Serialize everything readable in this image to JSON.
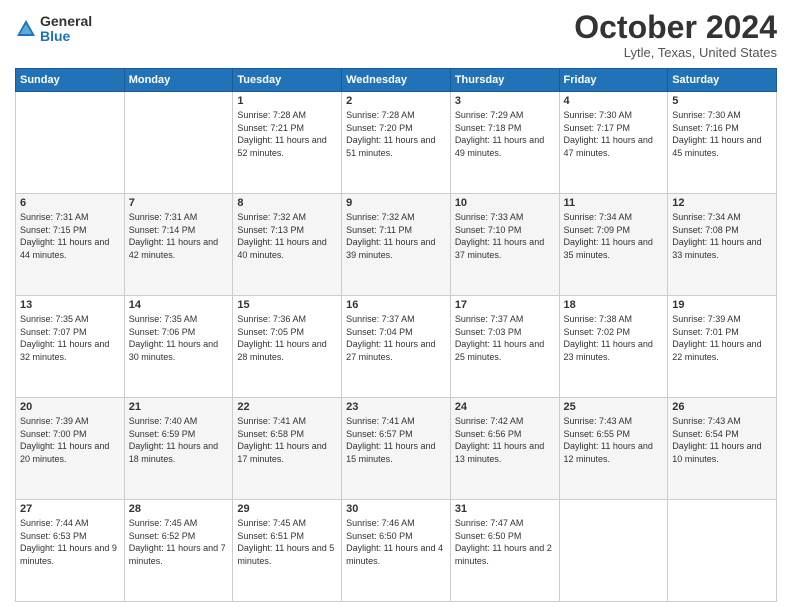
{
  "logo": {
    "general": "General",
    "blue": "Blue"
  },
  "title": {
    "month": "October 2024",
    "location": "Lytle, Texas, United States"
  },
  "days_header": [
    "Sunday",
    "Monday",
    "Tuesday",
    "Wednesday",
    "Thursday",
    "Friday",
    "Saturday"
  ],
  "weeks": [
    [
      {
        "day": "",
        "info": ""
      },
      {
        "day": "",
        "info": ""
      },
      {
        "day": "1",
        "info": "Sunrise: 7:28 AM\nSunset: 7:21 PM\nDaylight: 11 hours and 52 minutes."
      },
      {
        "day": "2",
        "info": "Sunrise: 7:28 AM\nSunset: 7:20 PM\nDaylight: 11 hours and 51 minutes."
      },
      {
        "day": "3",
        "info": "Sunrise: 7:29 AM\nSunset: 7:18 PM\nDaylight: 11 hours and 49 minutes."
      },
      {
        "day": "4",
        "info": "Sunrise: 7:30 AM\nSunset: 7:17 PM\nDaylight: 11 hours and 47 minutes."
      },
      {
        "day": "5",
        "info": "Sunrise: 7:30 AM\nSunset: 7:16 PM\nDaylight: 11 hours and 45 minutes."
      }
    ],
    [
      {
        "day": "6",
        "info": "Sunrise: 7:31 AM\nSunset: 7:15 PM\nDaylight: 11 hours and 44 minutes."
      },
      {
        "day": "7",
        "info": "Sunrise: 7:31 AM\nSunset: 7:14 PM\nDaylight: 11 hours and 42 minutes."
      },
      {
        "day": "8",
        "info": "Sunrise: 7:32 AM\nSunset: 7:13 PM\nDaylight: 11 hours and 40 minutes."
      },
      {
        "day": "9",
        "info": "Sunrise: 7:32 AM\nSunset: 7:11 PM\nDaylight: 11 hours and 39 minutes."
      },
      {
        "day": "10",
        "info": "Sunrise: 7:33 AM\nSunset: 7:10 PM\nDaylight: 11 hours and 37 minutes."
      },
      {
        "day": "11",
        "info": "Sunrise: 7:34 AM\nSunset: 7:09 PM\nDaylight: 11 hours and 35 minutes."
      },
      {
        "day": "12",
        "info": "Sunrise: 7:34 AM\nSunset: 7:08 PM\nDaylight: 11 hours and 33 minutes."
      }
    ],
    [
      {
        "day": "13",
        "info": "Sunrise: 7:35 AM\nSunset: 7:07 PM\nDaylight: 11 hours and 32 minutes."
      },
      {
        "day": "14",
        "info": "Sunrise: 7:35 AM\nSunset: 7:06 PM\nDaylight: 11 hours and 30 minutes."
      },
      {
        "day": "15",
        "info": "Sunrise: 7:36 AM\nSunset: 7:05 PM\nDaylight: 11 hours and 28 minutes."
      },
      {
        "day": "16",
        "info": "Sunrise: 7:37 AM\nSunset: 7:04 PM\nDaylight: 11 hours and 27 minutes."
      },
      {
        "day": "17",
        "info": "Sunrise: 7:37 AM\nSunset: 7:03 PM\nDaylight: 11 hours and 25 minutes."
      },
      {
        "day": "18",
        "info": "Sunrise: 7:38 AM\nSunset: 7:02 PM\nDaylight: 11 hours and 23 minutes."
      },
      {
        "day": "19",
        "info": "Sunrise: 7:39 AM\nSunset: 7:01 PM\nDaylight: 11 hours and 22 minutes."
      }
    ],
    [
      {
        "day": "20",
        "info": "Sunrise: 7:39 AM\nSunset: 7:00 PM\nDaylight: 11 hours and 20 minutes."
      },
      {
        "day": "21",
        "info": "Sunrise: 7:40 AM\nSunset: 6:59 PM\nDaylight: 11 hours and 18 minutes."
      },
      {
        "day": "22",
        "info": "Sunrise: 7:41 AM\nSunset: 6:58 PM\nDaylight: 11 hours and 17 minutes."
      },
      {
        "day": "23",
        "info": "Sunrise: 7:41 AM\nSunset: 6:57 PM\nDaylight: 11 hours and 15 minutes."
      },
      {
        "day": "24",
        "info": "Sunrise: 7:42 AM\nSunset: 6:56 PM\nDaylight: 11 hours and 13 minutes."
      },
      {
        "day": "25",
        "info": "Sunrise: 7:43 AM\nSunset: 6:55 PM\nDaylight: 11 hours and 12 minutes."
      },
      {
        "day": "26",
        "info": "Sunrise: 7:43 AM\nSunset: 6:54 PM\nDaylight: 11 hours and 10 minutes."
      }
    ],
    [
      {
        "day": "27",
        "info": "Sunrise: 7:44 AM\nSunset: 6:53 PM\nDaylight: 11 hours and 9 minutes."
      },
      {
        "day": "28",
        "info": "Sunrise: 7:45 AM\nSunset: 6:52 PM\nDaylight: 11 hours and 7 minutes."
      },
      {
        "day": "29",
        "info": "Sunrise: 7:45 AM\nSunset: 6:51 PM\nDaylight: 11 hours and 5 minutes."
      },
      {
        "day": "30",
        "info": "Sunrise: 7:46 AM\nSunset: 6:50 PM\nDaylight: 11 hours and 4 minutes."
      },
      {
        "day": "31",
        "info": "Sunrise: 7:47 AM\nSunset: 6:50 PM\nDaylight: 11 hours and 2 minutes."
      },
      {
        "day": "",
        "info": ""
      },
      {
        "day": "",
        "info": ""
      }
    ]
  ]
}
